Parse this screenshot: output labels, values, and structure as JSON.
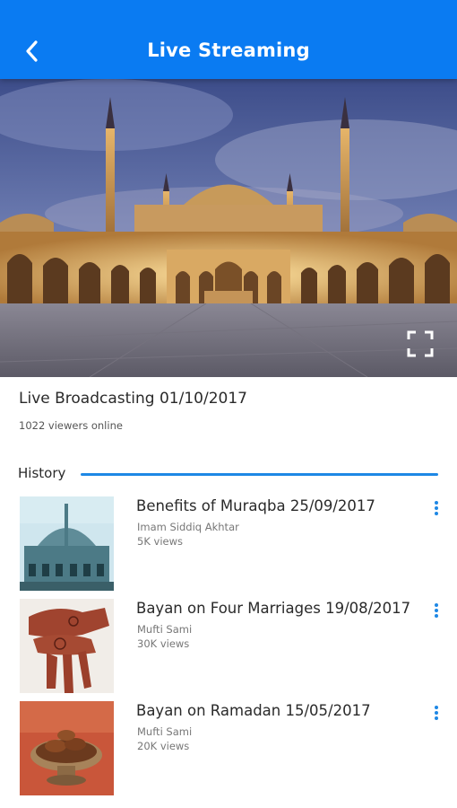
{
  "header": {
    "title": "Live Streaming",
    "back_icon": "chevron-left-icon",
    "color": "#0a7bf2"
  },
  "player": {
    "fullscreen_icon": "fullscreen-icon"
  },
  "live": {
    "title": "Live Broadcasting 01/10/2017",
    "viewers": "1022 viewers online"
  },
  "history": {
    "label": "History",
    "accent": "#1e88e5",
    "items": [
      {
        "title": "Benefits of Muraqba 25/09/2017",
        "author": "Imam Siddiq Akhtar",
        "views": "5K views"
      },
      {
        "title": "Bayan on Four Marriages 19/08/2017",
        "author": "Mufti Sami",
        "views": "30K views"
      },
      {
        "title": "Bayan on Ramadan 15/05/2017",
        "author": "Mufti Sami",
        "views": "20K views"
      }
    ]
  }
}
